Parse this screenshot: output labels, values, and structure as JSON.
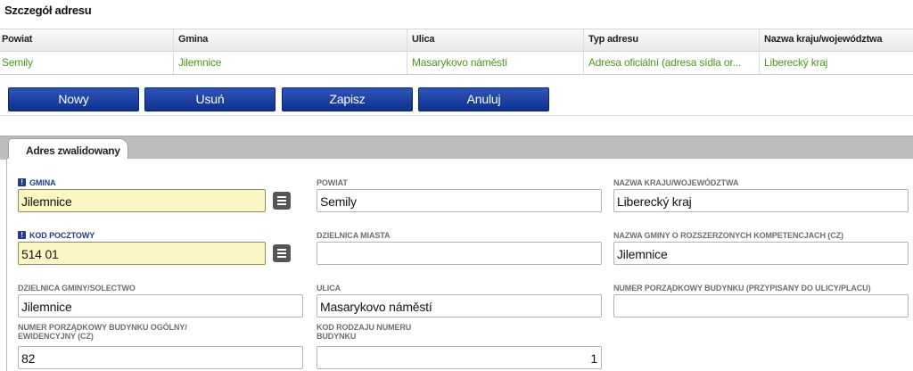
{
  "section_title": "Szczegół adresu",
  "grid": {
    "columns": [
      "Powiat",
      "Gmina",
      "Ulica",
      "Typ adresu",
      "Nazwa kraju/województwa"
    ],
    "rows": [
      [
        "Semily",
        "Jilemnice",
        "Masarykovo náměstí",
        "Adresa oficiální (adresa sídla or...",
        "Liberecký kraj"
      ]
    ]
  },
  "toolbar": {
    "new_label": "Nowy",
    "delete_label": "Usuń",
    "save_label": "Zapisz",
    "cancel_label": "Anuluj"
  },
  "tab": {
    "label": "Adres zwalidowany"
  },
  "form": {
    "gmina": {
      "label": "GMINA",
      "value": "Jilemnice",
      "required": true
    },
    "powiat": {
      "label": "POWIAT",
      "value": "Semily"
    },
    "nazwa_kraju": {
      "label": "NAZWA KRAJU/WOJEWÓDZTWA",
      "value": "Liberecký kraj"
    },
    "kod_pocztowy": {
      "label": "KOD POCZTOWY",
      "value": "514 01",
      "required": true
    },
    "dzielnica_miasta": {
      "label": "DZIELNICA MIASTA",
      "value": ""
    },
    "nazwa_gminy_rk": {
      "label": "NAZWA GMINY O ROZSZERZONYCH KOMPETENCJACH (CZ)",
      "value": "Jilemnice"
    },
    "dzielnica_gminy": {
      "label": "DZIELNICA GMINY/SOLECTWO",
      "value": "Jilemnice"
    },
    "ulica": {
      "label": "ULICA",
      "value": "Masarykovo náměstí"
    },
    "numer_porzadkowy_ulicy": {
      "label": "NUMER PORZĄDKOWY BUDYNKU (PRZYPISANY DO ULICY/PLACU)",
      "value": ""
    },
    "numer_porzadkowy_ogolny_1": {
      "label": "NUMER PORZĄDKOWY BUDYNKU OGÓLNY/",
      "value": "82"
    },
    "numer_porzadkowy_ogolny_2": {
      "label": "EWIDENCYJNY (CZ)"
    },
    "kod_rodzaju_1": {
      "label": "KOD RODZAJU NUMERU",
      "value": "1"
    },
    "kod_rodzaju_2": {
      "label": "BUDYNKU"
    }
  },
  "icons": {
    "required": "exclamation-icon",
    "picker": "list-icon"
  },
  "colors": {
    "accent": "#1d3c8f",
    "grid_value": "#4a9a1a",
    "required_bg": "#fcf6c3",
    "button": "#1a3c9e"
  }
}
